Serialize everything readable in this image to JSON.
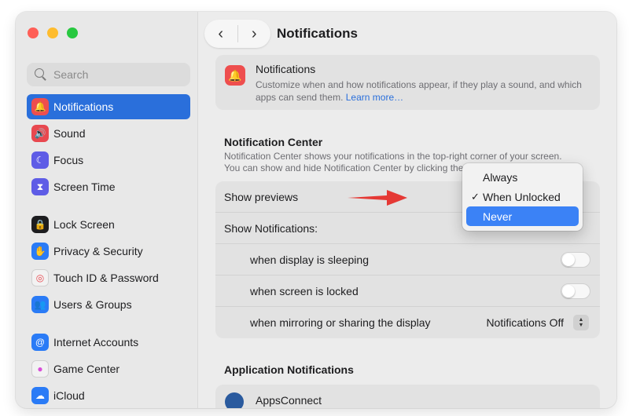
{
  "colors": {
    "accent": "#2a6fdb",
    "menu_highlight": "#3b82f6",
    "arrow": "#e53935"
  },
  "search": {
    "placeholder": "Search"
  },
  "sidebar": {
    "items": [
      {
        "label": "Notifications",
        "icon": "bell-icon",
        "color": "#ee4e4e",
        "active": true
      },
      {
        "label": "Sound",
        "icon": "speaker-icon",
        "color": "#e8484f"
      },
      {
        "label": "Focus",
        "icon": "moon-icon",
        "color": "#5e5ce6"
      },
      {
        "label": "Screen Time",
        "icon": "hourglass-icon",
        "color": "#5e5ce6"
      },
      {
        "label": "Lock Screen",
        "icon": "lock-icon",
        "color": "#1d1d1f"
      },
      {
        "label": "Privacy & Security",
        "icon": "hand-icon",
        "color": "#2a7bf6"
      },
      {
        "label": "Touch ID & Password",
        "icon": "fingerprint-icon",
        "color": "#f2f2f2"
      },
      {
        "label": "Users & Groups",
        "icon": "users-icon",
        "color": "#2a7bf6"
      },
      {
        "label": "Internet Accounts",
        "icon": "at-icon",
        "color": "#2a7bf6"
      },
      {
        "label": "Game Center",
        "icon": "game-center-icon",
        "color": "#f2f2f2"
      },
      {
        "label": "iCloud",
        "icon": "cloud-icon",
        "color": "#2a7bf6"
      }
    ]
  },
  "header": {
    "title": "Notifications",
    "back": "‹",
    "forward": "›"
  },
  "intro": {
    "title": "Notifications",
    "description": "Customize when and how notifications appear, if they play a sound, and which apps can send them.",
    "link": "Learn more…"
  },
  "notification_center": {
    "title": "Notification Center",
    "description_line1": "Notification Center shows your notifications in the top-right corner of your screen.",
    "description_line2": "You can show and hide Notification Center by clicking the"
  },
  "settings": {
    "show_previews": "Show previews",
    "show_notifications": "Show Notifications:",
    "display_sleeping": "when display is sleeping",
    "screen_locked": "when screen is locked",
    "mirroring": "when mirroring or sharing the display",
    "mirroring_value": "Notifications Off"
  },
  "dropdown": {
    "options": [
      {
        "label": "Always",
        "checked": false,
        "highlighted": false
      },
      {
        "label": "When Unlocked",
        "checked": true,
        "highlighted": false
      },
      {
        "label": "Never",
        "checked": false,
        "highlighted": true
      }
    ],
    "check_glyph": "✓"
  },
  "app_notifications": {
    "title": "Application Notifications",
    "first_app": "AppsConnect"
  }
}
